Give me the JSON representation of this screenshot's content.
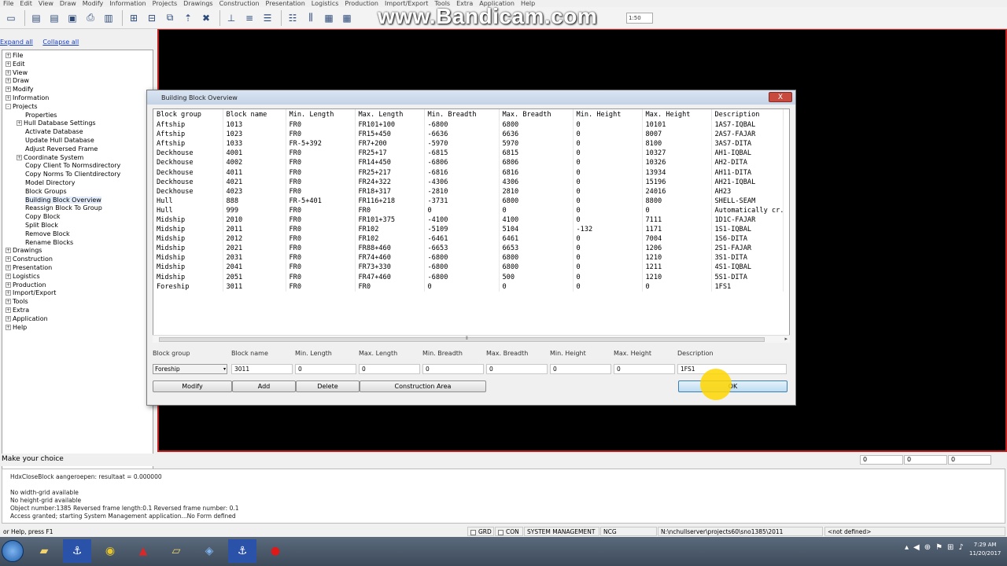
{
  "menu": [
    "File",
    "Edit",
    "View",
    "Draw",
    "Modify",
    "Information",
    "Projects",
    "Drawings",
    "Construction",
    "Presentation",
    "Logistics",
    "Production",
    "Import/Export",
    "Tools",
    "Extra",
    "Application",
    "Help"
  ],
  "watermark": "www.Bandicam.com",
  "toolbar_combo_value": "1:50",
  "tree_links": {
    "expand": "Expand all",
    "collapse": "Collapse all"
  },
  "tree": [
    {
      "label": "File",
      "level": 0,
      "pm": "+"
    },
    {
      "label": "Edit",
      "level": 0,
      "pm": "+"
    },
    {
      "label": "View",
      "level": 0,
      "pm": "+"
    },
    {
      "label": "Draw",
      "level": 0,
      "pm": "+"
    },
    {
      "label": "Modify",
      "level": 0,
      "pm": "+"
    },
    {
      "label": "Information",
      "level": 0,
      "pm": "+"
    },
    {
      "label": "Projects",
      "level": 0,
      "pm": "-"
    },
    {
      "label": "Properties",
      "level": 1,
      "pm": ""
    },
    {
      "label": "Hull Database Settings",
      "level": 1,
      "pm": "+"
    },
    {
      "label": "Activate Database",
      "level": 1,
      "pm": ""
    },
    {
      "label": "Update Hull Database",
      "level": 1,
      "pm": ""
    },
    {
      "label": "Adjust Reversed Frame",
      "level": 1,
      "pm": ""
    },
    {
      "label": "Coordinate System",
      "level": 1,
      "pm": "+"
    },
    {
      "label": "Copy Client To Normsdirectory",
      "level": 1,
      "pm": ""
    },
    {
      "label": "Copy Norms To Clientdirectory",
      "level": 1,
      "pm": ""
    },
    {
      "label": "Model Directory",
      "level": 1,
      "pm": ""
    },
    {
      "label": "Block Groups",
      "level": 1,
      "pm": ""
    },
    {
      "label": "Building Block Overview",
      "level": 1,
      "pm": "",
      "selected": true
    },
    {
      "label": "Reassign Block To Group",
      "level": 1,
      "pm": ""
    },
    {
      "label": "Copy Block",
      "level": 1,
      "pm": ""
    },
    {
      "label": "Split Block",
      "level": 1,
      "pm": ""
    },
    {
      "label": "Remove Block",
      "level": 1,
      "pm": ""
    },
    {
      "label": "Rename Blocks",
      "level": 1,
      "pm": ""
    },
    {
      "label": "Drawings",
      "level": 0,
      "pm": "+"
    },
    {
      "label": "Construction",
      "level": 0,
      "pm": "+"
    },
    {
      "label": "Presentation",
      "level": 0,
      "pm": "+"
    },
    {
      "label": "Logistics",
      "level": 0,
      "pm": "+"
    },
    {
      "label": "Production",
      "level": 0,
      "pm": "+"
    },
    {
      "label": "Import/Export",
      "level": 0,
      "pm": "+"
    },
    {
      "label": "Tools",
      "level": 0,
      "pm": "+"
    },
    {
      "label": "Extra",
      "level": 0,
      "pm": "+"
    },
    {
      "label": "Application",
      "level": 0,
      "pm": "+"
    },
    {
      "label": "Help",
      "level": 0,
      "pm": "+"
    }
  ],
  "dialog": {
    "title": "Building Block Overview",
    "close": "X",
    "columns": [
      "Block group",
      "Block name",
      "Min. Length",
      "Max. Length",
      "Min. Breadth",
      "Max. Breadth",
      "Min. Height",
      "Max. Height",
      "Description"
    ],
    "rows": [
      [
        "Aftship",
        "1013",
        "FR0",
        "FR101+100",
        "-6800",
        "6800",
        "0",
        "10101",
        "1AS7-IQBAL"
      ],
      [
        "Aftship",
        "1023",
        "FR0",
        "FR15+450",
        "-6636",
        "6636",
        "0",
        "8007",
        "2AS7-FAJAR"
      ],
      [
        "Aftship",
        "1033",
        "FR-5+392",
        "FR7+200",
        "-5970",
        "5970",
        "0",
        "8100",
        "3AS7-DITA"
      ],
      [
        "Deckhouse",
        "4001",
        "FR0",
        "FR25+17",
        "-6815",
        "6815",
        "0",
        "10327",
        "AH1-IQBAL"
      ],
      [
        "Deckhouse",
        "4002",
        "FR0",
        "FR14+450",
        "-6806",
        "6806",
        "0",
        "10326",
        "AH2-DITA"
      ],
      [
        "Deckhouse",
        "4011",
        "FR0",
        "FR25+217",
        "-6816",
        "6816",
        "0",
        "13934",
        "AH11-DITA"
      ],
      [
        "Deckhouse",
        "4021",
        "FR0",
        "FR24+322",
        "-4306",
        "4306",
        "0",
        "15196",
        "AH21-IQBAL"
      ],
      [
        "Deckhouse",
        "4023",
        "FR0",
        "FR18+317",
        "-2810",
        "2810",
        "0",
        "24016",
        "AH23"
      ],
      [
        "Hull",
        "888",
        "FR-5+401",
        "FR116+218",
        "-3731",
        "6800",
        "0",
        "8800",
        "SHELL-SEAM"
      ],
      [
        "Hull",
        "999",
        "FR0",
        "FR0",
        "0",
        "0",
        "0",
        "0",
        "Automatically cr."
      ],
      [
        "Midship",
        "2010",
        "FR0",
        "FR101+375",
        "-4100",
        "4100",
        "0",
        "7111",
        "1D1C-FAJAR"
      ],
      [
        "Midship",
        "2011",
        "FR0",
        "FR102",
        "-5109",
        "5104",
        "-132",
        "1171",
        "1S1-IQBAL"
      ],
      [
        "Midship",
        "2012",
        "FR0",
        "FR102",
        "-6461",
        "6461",
        "0",
        "7004",
        "1S6-DITA"
      ],
      [
        "Midship",
        "2021",
        "FR0",
        "FR88+460",
        "-6653",
        "6653",
        "0",
        "1206",
        "2S1-FAJAR"
      ],
      [
        "Midship",
        "2031",
        "FR0",
        "FR74+460",
        "-6800",
        "6800",
        "0",
        "1210",
        "3S1-DITA"
      ],
      [
        "Midship",
        "2041",
        "FR0",
        "FR73+330",
        "-6800",
        "6800",
        "0",
        "1211",
        "4S1-IQBAL"
      ],
      [
        "Midship",
        "2051",
        "FR0",
        "FR47+460",
        "-6800",
        "500",
        "0",
        "1210",
        "5S1-DITA"
      ],
      [
        "Foreship",
        "3011",
        "FR0",
        "FR0",
        "0",
        "0",
        "0",
        "0",
        "1FS1"
      ]
    ],
    "edit_labels": [
      "Block group",
      "Block name",
      "Min. Length",
      "Max. Length",
      "Min. Breadth",
      "Max. Breadth",
      "Min. Height",
      "Max. Height",
      "Description"
    ],
    "edit_values": [
      "Foreship",
      "3011",
      "0",
      "0",
      "0",
      "0",
      "0",
      "0",
      "1FS1"
    ],
    "buttons": {
      "modify": "Modify",
      "add": "Add",
      "delete": "Delete",
      "construction_area": "Construction Area",
      "ok": "OK"
    }
  },
  "prompt": "Make your choice",
  "coords": [
    "0",
    "0",
    "0"
  ],
  "output_lines": [
    "HdxCloseBlock aangeroepen: resultaat = 0.000000",
    "",
    "No width-grid available",
    "No height-grid available",
    "Object number:1385 Reversed frame length:0.1 Reversed frame number: 0.1",
    "Access granted; starting System Management application...No Form defined"
  ],
  "status": {
    "help": "or Help, press F1",
    "grd": "GRD",
    "con": "CON",
    "mode": "SYSTEM MANAGEMENT",
    "ncg": "NCG",
    "path": "N:\\nchullserver\\projects60\\sno1385\\2011",
    "undef": "<not defined>"
  },
  "clock": {
    "time": "7:29 AM",
    "date": "11/20/2017"
  }
}
